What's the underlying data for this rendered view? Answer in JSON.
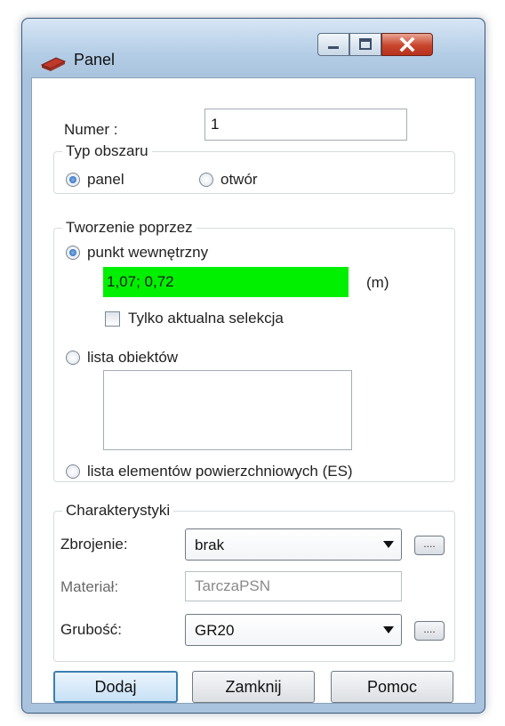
{
  "window": {
    "title": "Panel",
    "icon": "panel-icon",
    "controls": [
      "minimize-icon",
      "maximize-icon",
      "close-icon"
    ]
  },
  "numer": {
    "label": "Numer :",
    "value": "1"
  },
  "typ_obszaru": {
    "title": "Typ obszaru",
    "options": [
      {
        "label": "panel",
        "checked": true
      },
      {
        "label": "otwór",
        "checked": false
      }
    ]
  },
  "tworzenie": {
    "title": "Tworzenie poprzez",
    "punkt": {
      "label": "punkt wewnętrzny",
      "checked": true,
      "value": "1,07; 0,72",
      "unit": "(m)"
    },
    "tylko_label": "Tylko aktualna selekcja",
    "lista_obiektow": {
      "label": "lista obiektów",
      "checked": false
    },
    "lista_elementow": {
      "label": "lista elementów powierzchniowych (ES)",
      "checked": false
    }
  },
  "charakterystyki": {
    "title": "Charakterystyki",
    "zbrojenie": {
      "label": "Zbrojenie:",
      "value": "brak"
    },
    "material": {
      "label": "Materiał:",
      "value": "TarczaPSN"
    },
    "grubosc": {
      "label": "Grubość:",
      "value": "GR20"
    },
    "ellipsis_label": "...."
  },
  "buttons": {
    "dodaj": "Dodaj",
    "zamknij": "Zamknij",
    "pomoc": "Pomoc"
  },
  "colors": {
    "highlight": "#00f000",
    "title_bar": "#b4cde6",
    "close_button": "#c9452d",
    "default_button_border": "#3c7fb1"
  }
}
